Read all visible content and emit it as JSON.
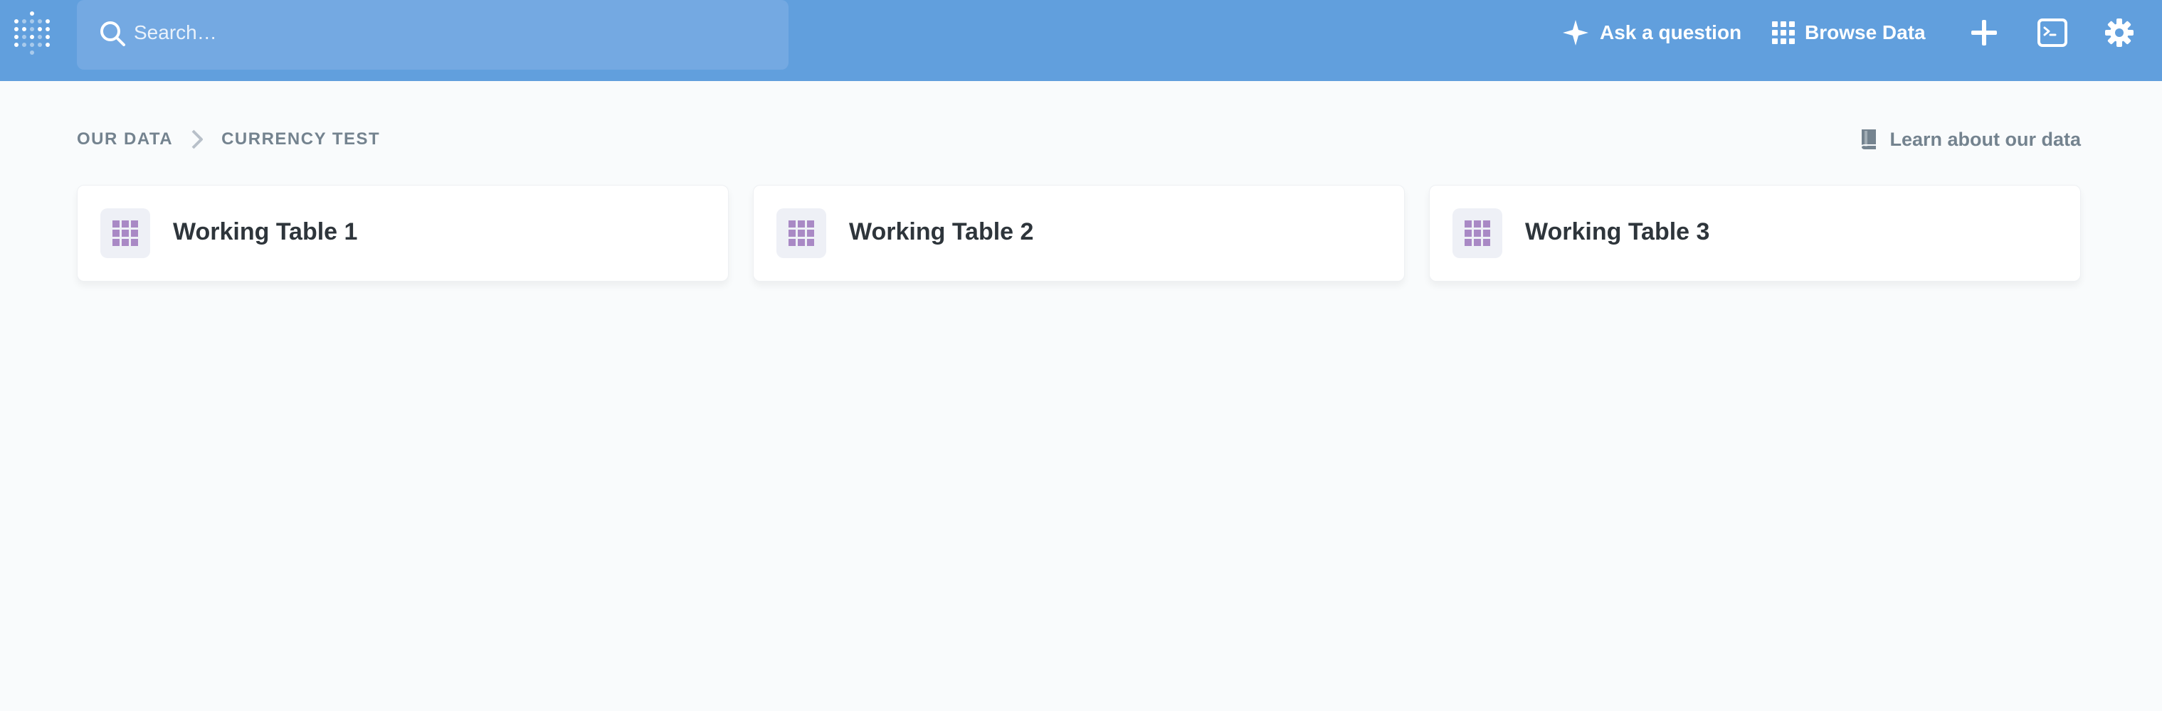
{
  "navbar": {
    "search_placeholder": "Search…",
    "ask_question_label": "Ask a question",
    "browse_data_label": "Browse Data",
    "icons": [
      "metabase-logo-icon",
      "search-icon",
      "sparkle-icon",
      "grid-icon",
      "plus-icon",
      "terminal-icon",
      "gear-icon"
    ]
  },
  "breadcrumb": {
    "items": [
      "OUR DATA",
      "CURRENCY TEST"
    ]
  },
  "learn_link": {
    "label": "Learn about our data",
    "icon": "book-icon"
  },
  "tables": [
    {
      "title": "Working Table 1",
      "icon": "table-icon"
    },
    {
      "title": "Working Table 2",
      "icon": "table-icon"
    },
    {
      "title": "Working Table 3",
      "icon": "table-icon"
    }
  ],
  "colors": {
    "navbar": "#619fdd",
    "search_bg": "#74a9e2",
    "table_icon": "#a989c5",
    "background": "#f9fbfc"
  }
}
